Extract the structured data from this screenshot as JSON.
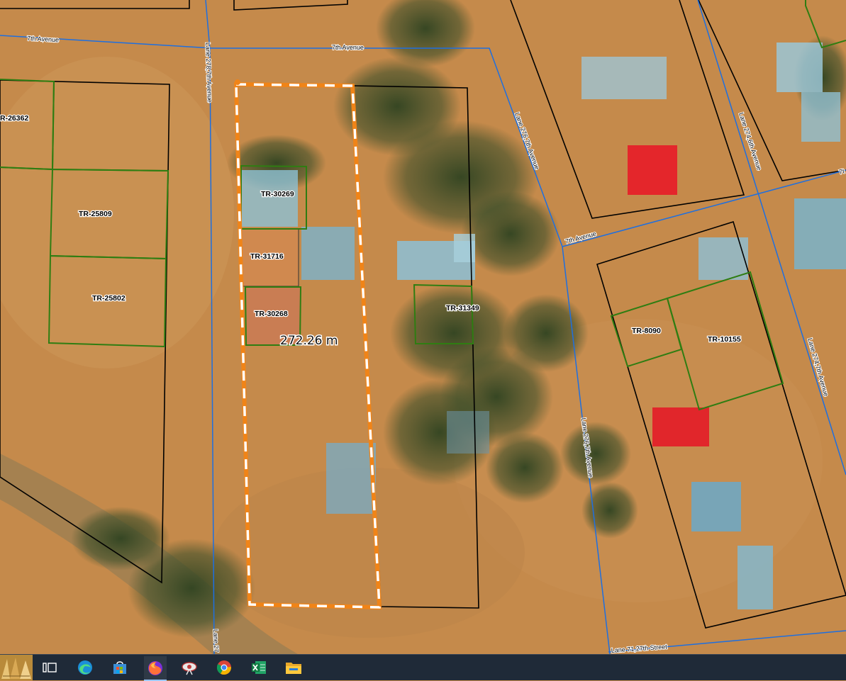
{
  "map": {
    "roads": {
      "r1": "7th Avenue",
      "r2": "7th Avenue",
      "r3": "7th Avenue",
      "r4": "Lane 278,7th Avenue",
      "r5": "Lane 276,7th Avenue",
      "r6": "Lane 276,7th Avenue",
      "r7": "Lane 274,6th Avenue",
      "r8": "Lane 274,7th Avenue",
      "r9": "Lane 27",
      "r10": "Lane 71,27th Street",
      "r11": "7t"
    },
    "parcels": {
      "p1": "R-26362",
      "p2": "TR-25809",
      "p3": "TR-25802",
      "p4": "TR-30269",
      "p5": "TR-31716",
      "p6": "TR-30268",
      "p7": "TR-31349",
      "p8": "TR-8090",
      "p9": "TR-10155"
    },
    "measurement": "272.26 m",
    "colors": {
      "road_line": "#1e6fe0",
      "parcel_outline_green": "#2f7d12",
      "parcel_outline_black": "#000000",
      "selection_orange": "#f08418",
      "selected_parcel_fill": "#d0894f",
      "terrain": "#c58a4b",
      "vegetation": "#3c4f2a"
    }
  },
  "taskbar": {
    "icons": [
      "start-icon",
      "task-view-icon",
      "edge-icon",
      "store-icon",
      "firefox-icon",
      "satellite-app-icon",
      "chrome-icon",
      "excel-icon",
      "file-explorer-icon"
    ],
    "active_app": "firefox-icon"
  }
}
